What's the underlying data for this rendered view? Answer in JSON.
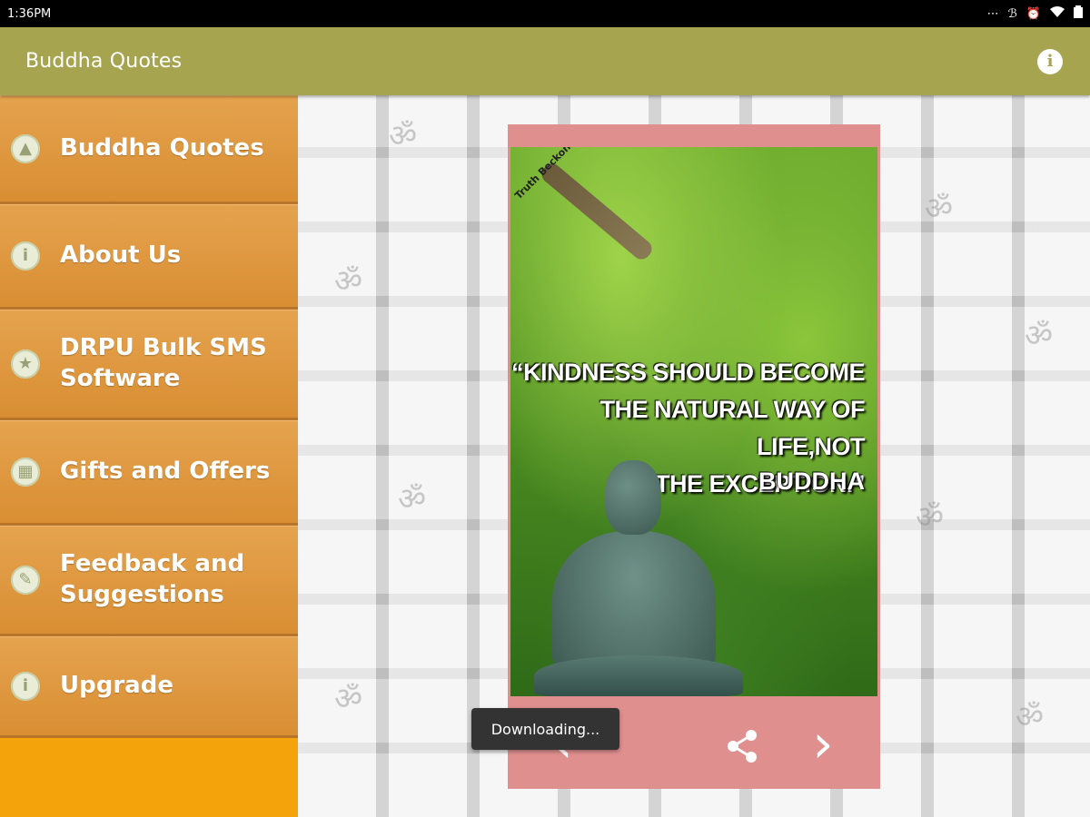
{
  "status_bar": {
    "time": "1:36PM",
    "icons": [
      "notifications-icon",
      "bluetooth-icon",
      "alarm-icon",
      "wifi-icon",
      "battery-icon"
    ]
  },
  "app_bar": {
    "title": "Buddha Quotes",
    "info_icon": "info-icon",
    "bar_color": "#a6a44f"
  },
  "drawer": {
    "items": [
      {
        "label": "Buddha Quotes",
        "icon": "buddha-icon"
      },
      {
        "label": "About Us",
        "icon": "info-icon"
      },
      {
        "label": "DRPU Bulk SMS\nSoftware",
        "icon": "star-icon"
      },
      {
        "label": "Gifts and Offers",
        "icon": "gift-icon"
      },
      {
        "label": "Feedback and\nSuggestions",
        "icon": "feedback-icon"
      },
      {
        "label": "Upgrade",
        "icon": "info-icon"
      }
    ],
    "color": "#f5a30b"
  },
  "quote_card": {
    "watermark": "Truth Beckons",
    "quote": "“KINDNESS SHOULD BECOME\nTHE NATURAL WAY OF LIFE,NOT\nTHE EXCEPTION.”",
    "author": "BUDDHA",
    "prev_icon": "chevron-left-icon",
    "next_icon": "chevron-right-icon",
    "share_icon": "share-icon",
    "frame_color": "#e08f8f"
  },
  "toast": {
    "message": "Downloading..."
  }
}
